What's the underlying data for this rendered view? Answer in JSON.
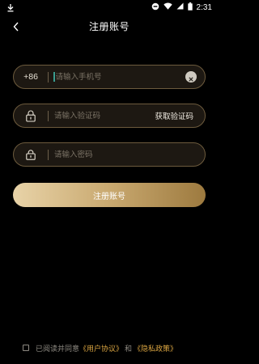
{
  "status_bar": {
    "time": "2:31",
    "icons": [
      "download-icon",
      "minus-circle-icon",
      "wifi-icon",
      "signal-icon",
      "battery-icon"
    ]
  },
  "nav": {
    "title": "注册账号",
    "back_icon": "chevron-left-icon"
  },
  "form": {
    "phone": {
      "prefix": "+86",
      "placeholder": "请输入手机号",
      "value": "",
      "clear_icon": "clear-icon"
    },
    "code": {
      "icon": "lock-icon",
      "placeholder": "请输入验证码",
      "value": "",
      "get_code_label": "获取验证码"
    },
    "password": {
      "icon": "lock-icon",
      "placeholder": "请输入密码",
      "value": ""
    },
    "submit_label": "注册账号"
  },
  "agreement": {
    "prefix": "已阅读并同意",
    "user_agreement": "《用户协议》",
    "and": "和",
    "privacy_policy": "《隐私政策》",
    "checked": false
  },
  "colors": {
    "background": "#000000",
    "field_border": "#6d5b3d",
    "field_fill": "#1d1812",
    "button_gradient_start": "#e8d3a8",
    "button_gradient_end": "#9d7a3f",
    "link": "#d9a441"
  }
}
